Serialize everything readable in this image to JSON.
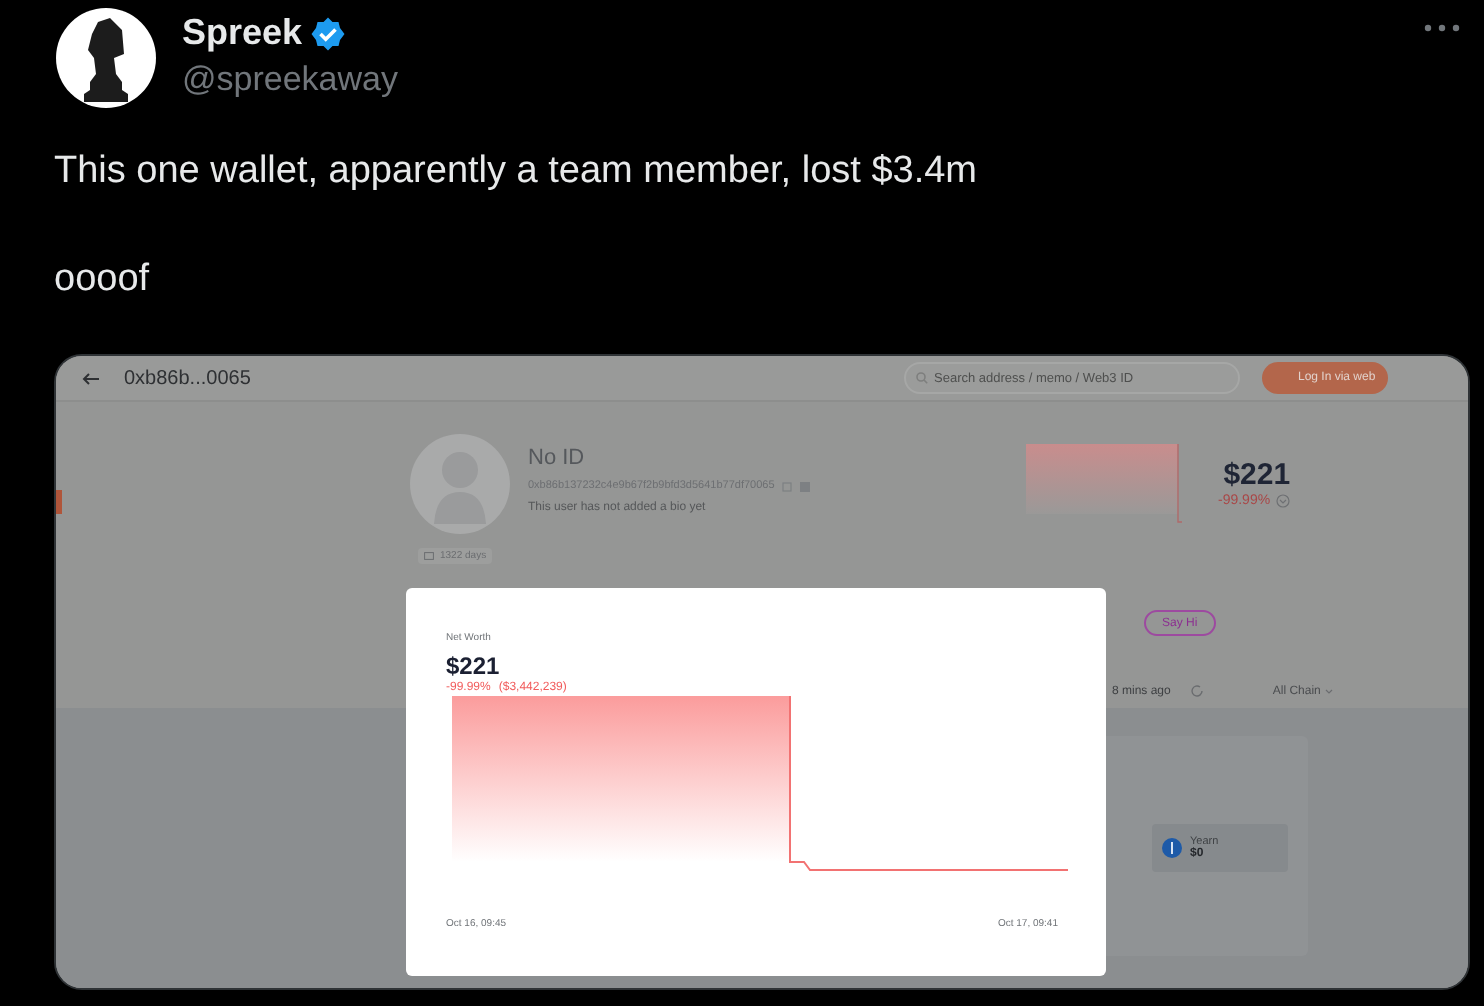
{
  "tweet": {
    "author": {
      "name": "Spreek",
      "verified": true,
      "handle": "@spreekaway"
    },
    "text": [
      "This one wallet, apparently a team member, lost $3.4m",
      "oooof"
    ],
    "media": {
      "top_bar": {
        "address": "0xb86b...0065",
        "search": {
          "placeholder": "Search address / memo / Web3 ID"
        },
        "login_button": "Log In via web"
      },
      "profile": {
        "name": "No ID",
        "address": "0xb86b137232c4e9b67f2b9bfd3d5641b77df70065",
        "bio": "This user has not added a bio yet",
        "age": "1322 days",
        "net_worth": "$221",
        "change": "-99.99%",
        "say_hi": "Say Hi",
        "updated": "8 mins ago",
        "chain_filter": "All Chain"
      },
      "assets": [
        {
          "name": "Yearn",
          "value": "$0"
        }
      ],
      "modal": {
        "label": "Net Worth",
        "value": "$221",
        "change": "-99.99%",
        "change_amount": "($3,442,239)",
        "start": "Oct 16, 09:45",
        "end": "Oct 17, 09:41"
      }
    }
  }
}
